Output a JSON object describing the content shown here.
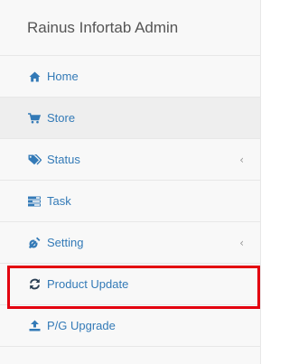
{
  "brand": {
    "title": "Rainus Infortab Admin"
  },
  "menu": [
    {
      "label": "Home",
      "icon": "home-icon",
      "has_submenu": false,
      "active": false
    },
    {
      "label": "Store",
      "icon": "cart-icon",
      "has_submenu": false,
      "active": true
    },
    {
      "label": "Status",
      "icon": "tags-icon",
      "has_submenu": true,
      "active": false
    },
    {
      "label": "Task",
      "icon": "tasks-icon",
      "has_submenu": false,
      "active": false
    },
    {
      "label": "Setting",
      "icon": "wrench-icon",
      "has_submenu": true,
      "active": false
    },
    {
      "label": "Product Update",
      "icon": "refresh-icon",
      "has_submenu": false,
      "active": false,
      "highlighted": true
    },
    {
      "label": "P/G Upgrade",
      "icon": "upload-icon",
      "has_submenu": false,
      "active": false
    }
  ],
  "chevron_glyph": "‹",
  "colors": {
    "link": "#337ab7",
    "highlight_border": "#e3000f",
    "sidebar_bg": "#f8f8f8",
    "active_bg": "#eeeeee"
  }
}
